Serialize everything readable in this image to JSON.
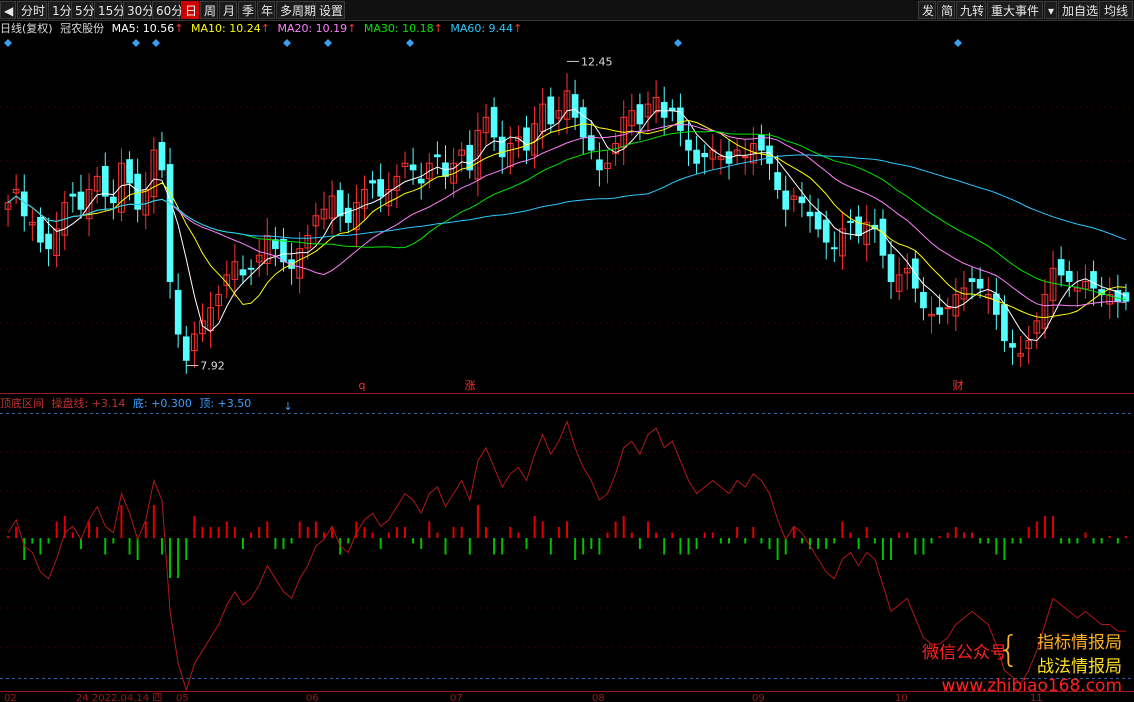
{
  "toolbar": {
    "left": [
      "分时",
      "1分",
      "5分",
      "15分",
      "30分",
      "60分",
      "日",
      "周",
      "月",
      "季",
      "年",
      "多周期",
      "设置"
    ],
    "active": "日",
    "right": [
      "发",
      "简",
      "九转",
      "重大事件",
      "加自选",
      "均线"
    ]
  },
  "main_legend": {
    "title": "日线(复权)",
    "stock_name": "冠农股份",
    "ma5": "MA5: 10.56",
    "ma10": "MA10: 10.24",
    "ma20": "MA20: 10.19",
    "ma30": "MA30: 10.18",
    "ma60": "MA60: 9.44",
    "arrow": "↑"
  },
  "price_annotations": {
    "high": "12.45",
    "low": "7.92"
  },
  "event_markers": [
    "q",
    "涨",
    "财"
  ],
  "indicator_legend": {
    "name": "顶底区间",
    "line1": "操盘线: +3.14",
    "line2": "底: +0.300",
    "line3": "顶: +3.50"
  },
  "axis_labels": [
    "02",
    "24 2022.04.14 四",
    "05",
    "06",
    "07",
    "08",
    "09",
    "10",
    "11"
  ],
  "watermark": {
    "left": "微信公众号",
    "top_right": "指标情报局",
    "bottom_right": "战法情报局",
    "url": "www.zhibiao168.com"
  },
  "colors": {
    "up": "#ff3232",
    "down": "#54ffff",
    "ma5": "#ffffff",
    "ma10": "#ffff00",
    "ma20": "#ff80ff",
    "ma30": "#00e600",
    "ma60": "#2dc8ff",
    "bar_up": "#e00000",
    "bar_down": "#00c000"
  }
}
